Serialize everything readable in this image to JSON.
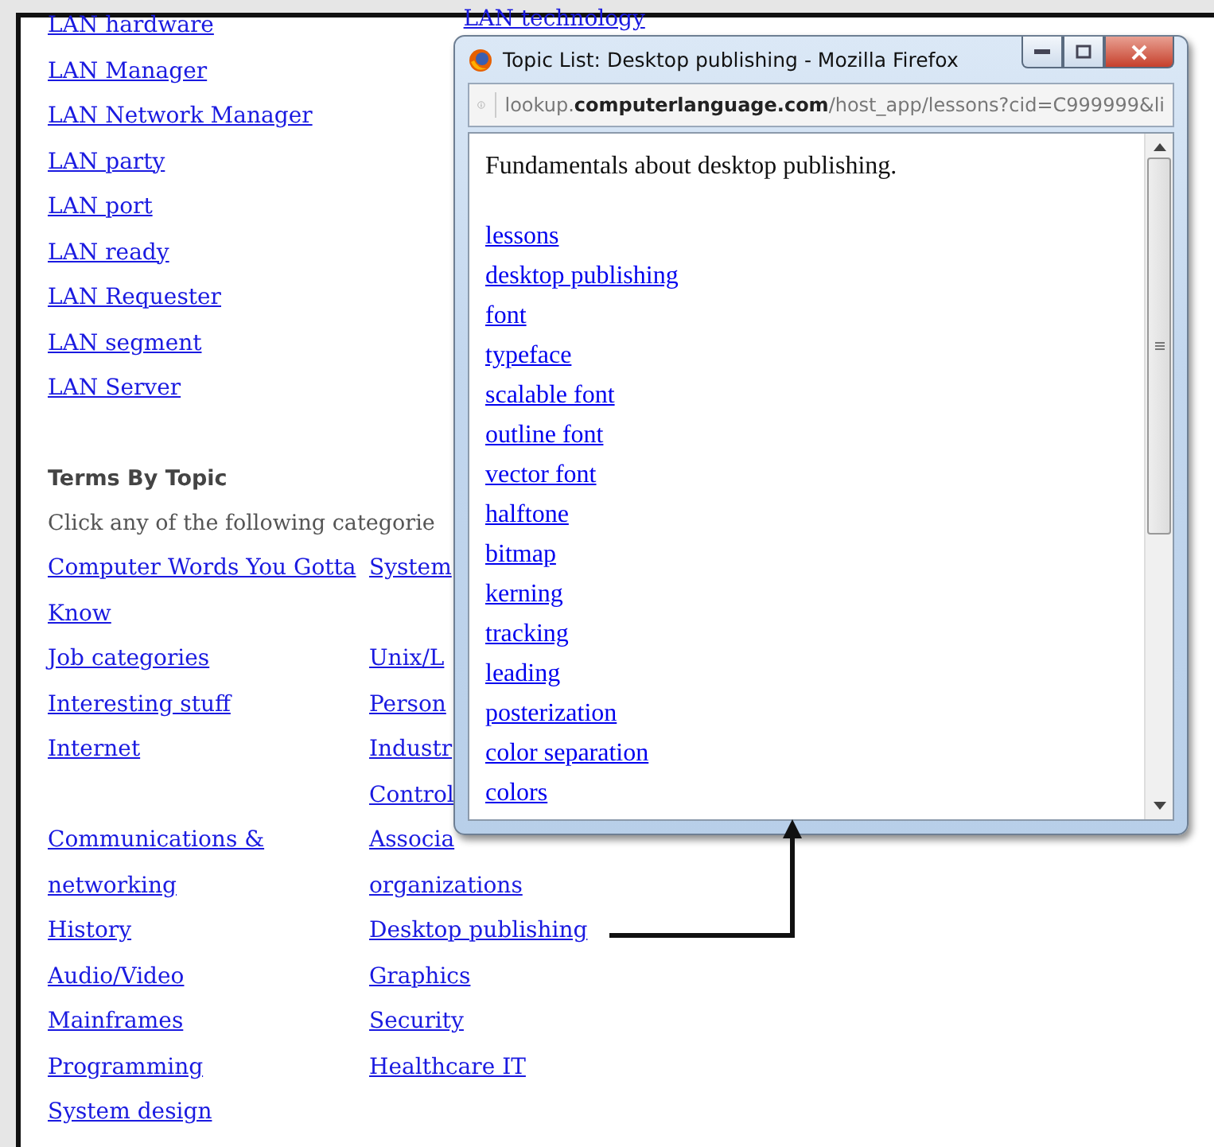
{
  "page": {
    "links_top": [
      "LAN hardware",
      "LAN Manager",
      "LAN Network Manager",
      "LAN party",
      "LAN port",
      "LAN ready",
      "LAN Requester",
      "LAN segment",
      "LAN Server"
    ],
    "link_top_right": "LAN technology",
    "section_title": "Terms By Topic",
    "intro": "Click any of the following categorie",
    "topic_rows": [
      {
        "left": [
          "Computer Words You Gotta Know"
        ],
        "right": [
          "System"
        ]
      },
      {
        "left": [
          "Job categories"
        ],
        "right": [
          "Unix/L"
        ]
      },
      {
        "left": [
          "Interesting stuff"
        ],
        "right": [
          "Person"
        ]
      },
      {
        "left": [
          "Internet"
        ],
        "right": [
          "Industr",
          "Control"
        ]
      },
      {
        "left": [
          "Communications & networking"
        ],
        "right": [
          "Associa",
          "organizations"
        ]
      },
      {
        "left": [
          "History"
        ],
        "right": [
          "Desktop publishing"
        ]
      },
      {
        "left": [
          "Audio/Video"
        ],
        "right": [
          "Graphics"
        ]
      },
      {
        "left": [
          "Mainframes"
        ],
        "right": [
          "Security"
        ]
      },
      {
        "left": [
          "Programming"
        ],
        "right": [
          "Healthcare IT"
        ]
      },
      {
        "left": [
          "System design"
        ],
        "right": []
      }
    ]
  },
  "popup": {
    "title": "Topic List: Desktop publishing - Mozilla Firefox",
    "url": "lookup.**computerlanguage.com**/host_app/lessons?cid=C999999&li",
    "description": "Fundamentals about desktop publishing.",
    "links": [
      "lessons",
      "desktop publishing",
      "font",
      "typeface",
      "scalable font",
      "outline font",
      "vector font",
      "halftone",
      "bitmap",
      "kerning",
      "tracking",
      "leading",
      "posterization",
      "color separation",
      "colors"
    ]
  }
}
